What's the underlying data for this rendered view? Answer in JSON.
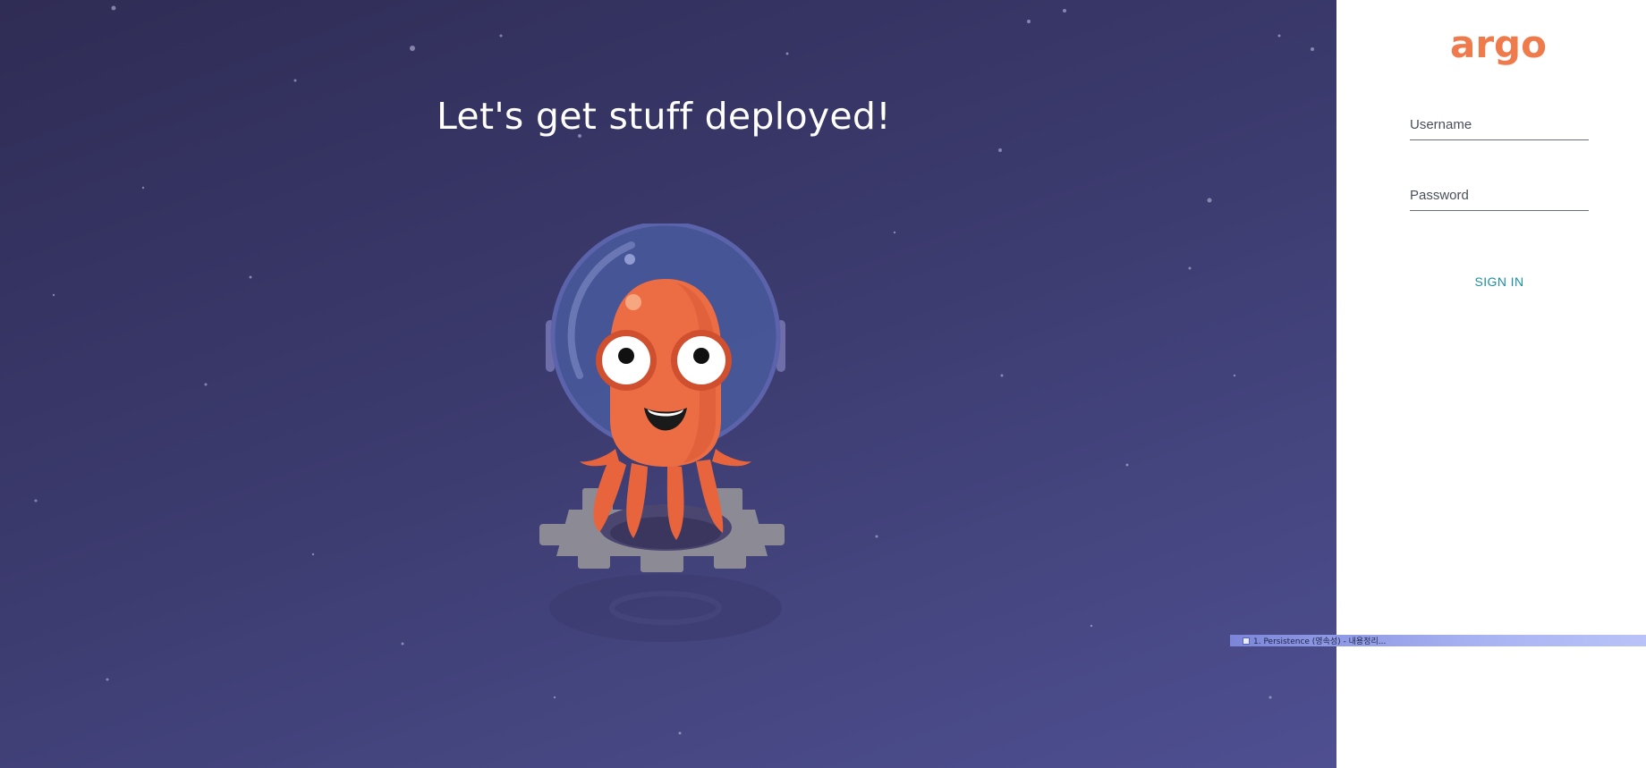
{
  "hero": {
    "title": "Let's get stuff deployed!",
    "mascot_icon": "argo-octopus-astronaut-icon"
  },
  "login": {
    "logo_text": "argo",
    "username_placeholder": "Username",
    "password_placeholder": "Password",
    "signin_label": "SIGN IN"
  },
  "taskbar": {
    "item_label": "1. Persistence (영속성) - 내용정리..."
  },
  "colors": {
    "hero_bg_top": "#2f2c55",
    "hero_bg_bottom": "#4e4f91",
    "brand_orange": "#ef7b4d",
    "signin_teal": "#1d8fa0",
    "panel_bg": "#ffffff"
  }
}
